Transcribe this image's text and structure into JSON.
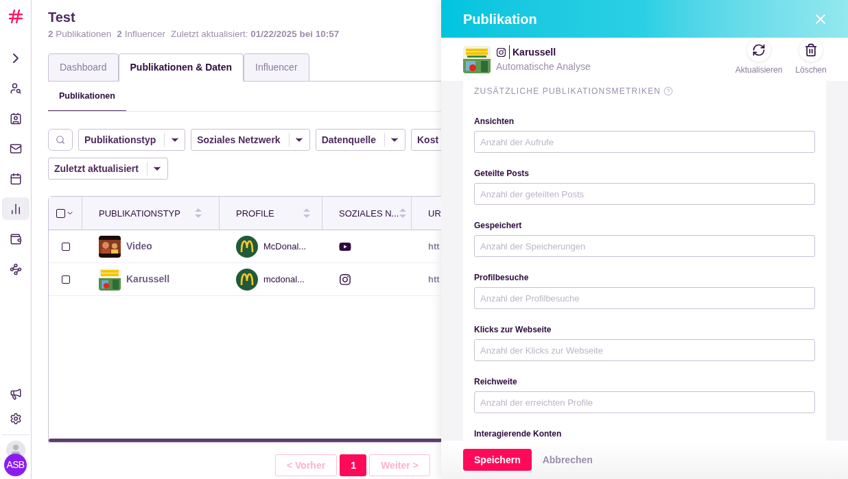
{
  "sidebar": {
    "items": [
      {
        "kind": "expand",
        "selected": false
      },
      {
        "kind": "user-search",
        "selected": false
      },
      {
        "kind": "contacts",
        "selected": false
      },
      {
        "kind": "mail",
        "selected": false
      },
      {
        "kind": "calendar",
        "selected": false
      },
      {
        "kind": "chart",
        "selected": true
      },
      {
        "kind": "wallet",
        "selected": false
      },
      {
        "kind": "network",
        "selected": false
      }
    ],
    "bottom_items": [
      {
        "kind": "megaphone"
      },
      {
        "kind": "settings"
      }
    ],
    "user": {
      "initials": "ASB"
    }
  },
  "header": {
    "title": "Test",
    "stats": [
      {
        "count": "2",
        "label": "Publikationen"
      },
      {
        "count": "2",
        "label": "Influencer"
      }
    ],
    "updated_label": "Zuletzt aktualisiert:",
    "updated_value": "01/22/2025 bei 10:57"
  },
  "tabs": [
    {
      "label": "Dashboard",
      "selected": false
    },
    {
      "label": "Publikationen & Daten",
      "selected": true
    },
    {
      "label": "Influencer",
      "selected": false
    }
  ],
  "subtabs": [
    {
      "label": "Publikationen",
      "selected": true
    }
  ],
  "filters": [
    {
      "label": "Publikationstyp",
      "caret": true
    },
    {
      "label": "Soziales Netzwerk",
      "caret": true
    },
    {
      "label": "Datenquelle",
      "caret": true
    },
    {
      "label": "Kost",
      "caret": false
    },
    {
      "label": "Zuletzt aktualisiert",
      "caret": true
    }
  ],
  "table": {
    "select_all": {
      "checked": false
    },
    "columns": [
      {
        "label": "PUBLIKATIONSTYP",
        "sortable": true
      },
      {
        "label": "PROFILE",
        "sortable": true
      },
      {
        "label": "SOZIALES N...",
        "sortable": true
      },
      {
        "label": "UR"
      }
    ],
    "rows": [
      {
        "checked": false,
        "type": "Video",
        "profile": "McDonal...",
        "network": {
          "kind": "youtube"
        },
        "url": "htt"
      },
      {
        "checked": false,
        "type": "Karussell",
        "profile": "mcdonal...",
        "network": {
          "kind": "instagram"
        },
        "url": "htt"
      }
    ]
  },
  "pagination": [
    {
      "label": "< Vorher",
      "disabled": true,
      "selected": false
    },
    {
      "label": "1",
      "disabled": false,
      "selected": true
    },
    {
      "label": "Weiter >",
      "disabled": true,
      "selected": false
    }
  ],
  "panel": {
    "title": "Publikation",
    "publication": {
      "network": {
        "kind": "instagram"
      },
      "type": "Karussell",
      "source": "Automatische Analyse"
    },
    "actions": [
      {
        "kind": "refresh",
        "label": "Aktualisieren"
      },
      {
        "kind": "delete",
        "label": "Löschen"
      }
    ],
    "section_title": "ZUSÄTZLICHE PUBLIKATIONSMETRIKEN",
    "fields": [
      {
        "label": "Ansichten",
        "placeholder": "Anzahl der Aufrufe"
      },
      {
        "label": "Geteilte Posts",
        "placeholder": "Anzahl der geteilten Posts"
      },
      {
        "label": "Gespeichert",
        "placeholder": "Anzahl der Speicherungen"
      },
      {
        "label": "Profilbesuche",
        "placeholder": "Anzahl der Profilbesuche"
      },
      {
        "label": "Klicks zur Webseite",
        "placeholder": "Anzahl der Klicks zur Webseite"
      },
      {
        "label": "Reichweite",
        "placeholder": "Anzahl der erreichten Profile"
      },
      {
        "label": "Interagierende Konten"
      }
    ],
    "save": "Speichern",
    "cancel": "Abbrechen"
  }
}
